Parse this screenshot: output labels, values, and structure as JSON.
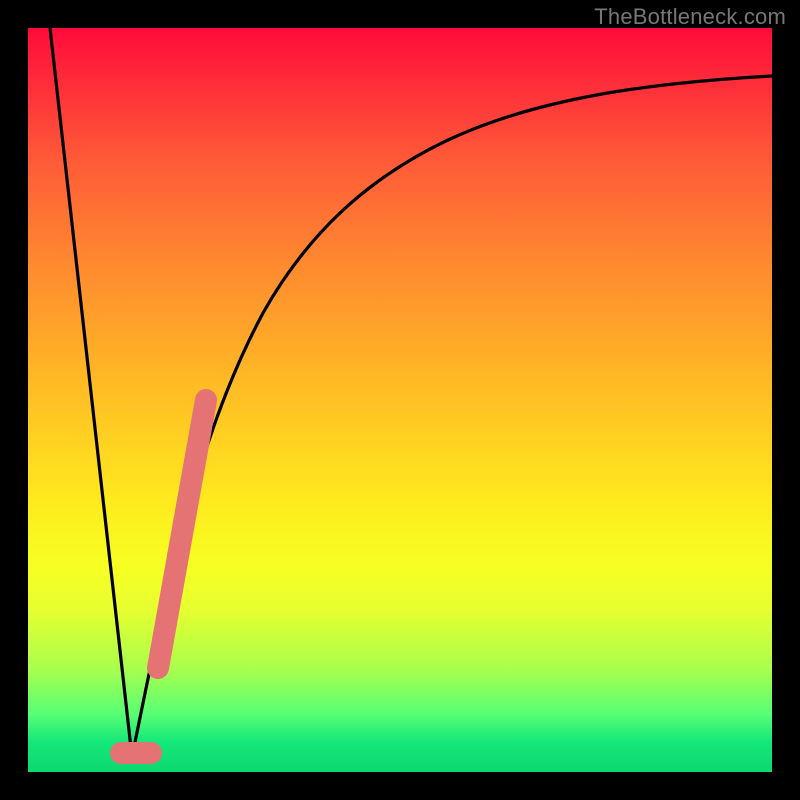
{
  "watermark": "TheBottleneck.com",
  "colors": {
    "background": "#000000",
    "gradient_top": "#ff0b3a",
    "gradient_bottom": "#0cd970",
    "curve": "#000000",
    "highlight": "#e57373"
  },
  "chart_data": {
    "type": "line",
    "title": "",
    "xlabel": "",
    "ylabel": "",
    "xlim": [
      0,
      100
    ],
    "ylim": [
      0,
      100
    ],
    "grid": false,
    "legend": false,
    "series": [
      {
        "name": "left-descent",
        "x": [
          3,
          14
        ],
        "values": [
          100,
          2
        ]
      },
      {
        "name": "saturating-curve",
        "x": [
          14,
          16,
          18,
          20,
          22,
          24,
          27,
          30,
          34,
          38,
          44,
          52,
          62,
          74,
          86,
          100
        ],
        "values": [
          2,
          14,
          24,
          33,
          41,
          48,
          56,
          62,
          68,
          73,
          78,
          83,
          87,
          90,
          92,
          93.5
        ]
      }
    ],
    "highlights": [
      {
        "name": "diagonal-pink-segment",
        "x": [
          17.5,
          24
        ],
        "values": [
          14,
          50
        ]
      },
      {
        "name": "flat-pink-segment",
        "x": [
          12.5,
          16.5
        ],
        "values": [
          2.5,
          2.5
        ]
      }
    ]
  }
}
